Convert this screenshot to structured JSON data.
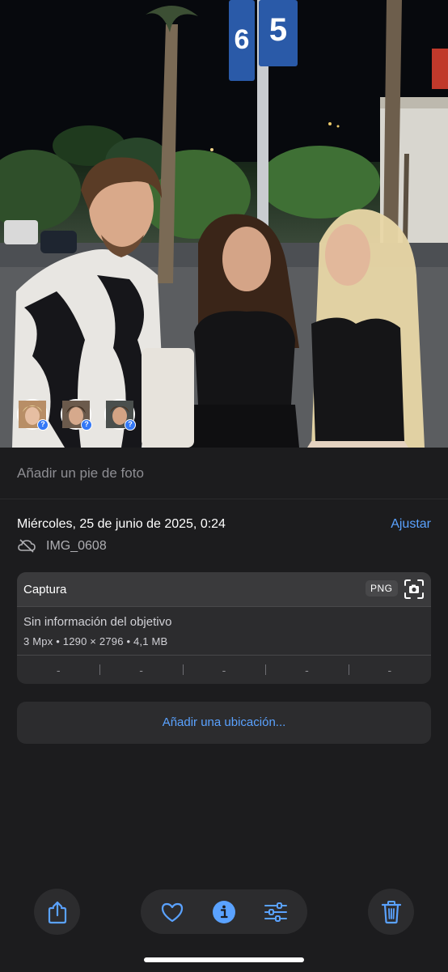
{
  "photo": {
    "faces": [
      {
        "name": "face-1",
        "badge": "?"
      },
      {
        "name": "face-2",
        "badge": "?"
      },
      {
        "name": "face-3",
        "badge": "?"
      }
    ],
    "sign_numbers": [
      "6",
      "5"
    ]
  },
  "caption": {
    "placeholder": "Añadir un pie de foto"
  },
  "info": {
    "date": "Miércoles, 25 de junio de 2025, 0:24",
    "adjust_label": "Ajustar",
    "file_name": "IMG_0608",
    "card": {
      "title": "Captura",
      "format_badge": "PNG",
      "lens_text": "Sin información del objetivo",
      "specs": "3 Mpx  •  1290 × 2796  •  4,1 MB",
      "exif": [
        "-",
        "-",
        "-",
        "-",
        "-"
      ]
    },
    "location_label": "Añadir una ubicación..."
  },
  "toolbar": {
    "share_icon": "share-icon",
    "favorite_icon": "heart-icon",
    "info_icon": "info-icon",
    "edit_icon": "sliders-icon",
    "delete_icon": "trash-icon"
  },
  "colors": {
    "accent": "#5aa2ff",
    "background": "#1c1c1e",
    "card": "#2c2c2e",
    "card_header": "#3a3a3c"
  }
}
